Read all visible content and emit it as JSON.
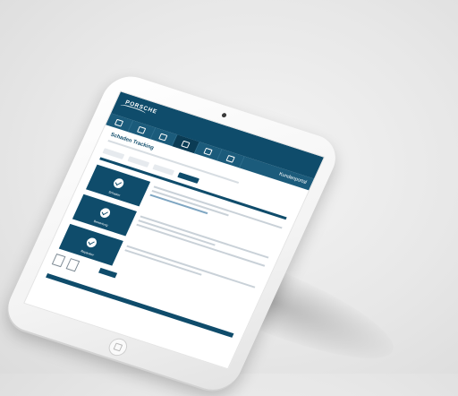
{
  "device": {
    "type": "tablet",
    "color": "#ffffff",
    "camera_icon": "camera-dot",
    "home_button_icon": "home-button"
  },
  "app": {
    "brand": "PORSCHE",
    "nav_icons": [
      "home-icon",
      "car-icon",
      "calendar-icon",
      "car-icon",
      "service-icon",
      "document-icon",
      "user-icon"
    ],
    "accent_color": "#0f4c6b",
    "nav_title": "Kundenportal"
  },
  "page": {
    "title": "Schaden Tracking"
  },
  "steps": [
    {
      "label": "Schaden"
    },
    {
      "label": "Bewertung"
    },
    {
      "label": "Reparatur"
    }
  ]
}
